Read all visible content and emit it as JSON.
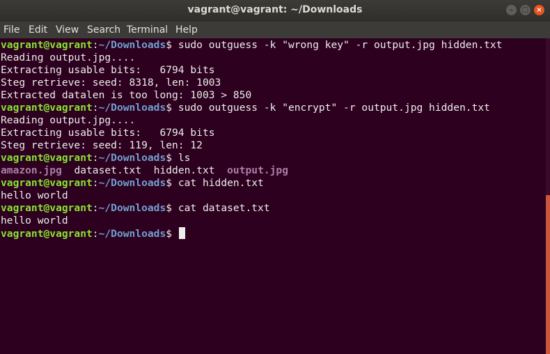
{
  "window": {
    "title": "vagrant@vagrant: ~/Downloads"
  },
  "menu": {
    "file": "File",
    "edit": "Edit",
    "view": "View",
    "search": "Search",
    "terminal": "Terminal",
    "help": "Help"
  },
  "terminal": {
    "prompt_user": "vagrant@vagrant",
    "prompt_colon": ":",
    "prompt_path": "~/Downloads",
    "prompt_dollar": "$ ",
    "cmd1": "sudo outguess -k \"wrong key\" -r output.jpg hidden.txt",
    "out1": [
      "Reading output.jpg....",
      "Extracting usable bits:   6794 bits",
      "Steg retrieve: seed: 8318, len: 1003",
      "Extracted datalen is too long: 1003 > 850"
    ],
    "cmd2": "sudo outguess -k \"encrypt\" -r output.jpg hidden.txt",
    "out2": [
      "Reading output.jpg....",
      "Extracting usable bits:   6794 bits",
      "Steg retrieve: seed: 119, len: 12"
    ],
    "cmd3": "ls",
    "ls_files": [
      "amazon.jpg",
      "dataset.txt",
      "hidden.txt",
      "output.jpg"
    ],
    "cmd4": "cat hidden.txt",
    "out4": "hello world",
    "cmd5": "cat dataset.txt",
    "out5": "hello world"
  },
  "colors": {
    "background": "#2c001e",
    "prompt_user": "#8ae234",
    "prompt_path": "#729fcf",
    "image_file": "#ad7fa8",
    "text": "#eeeeec"
  }
}
